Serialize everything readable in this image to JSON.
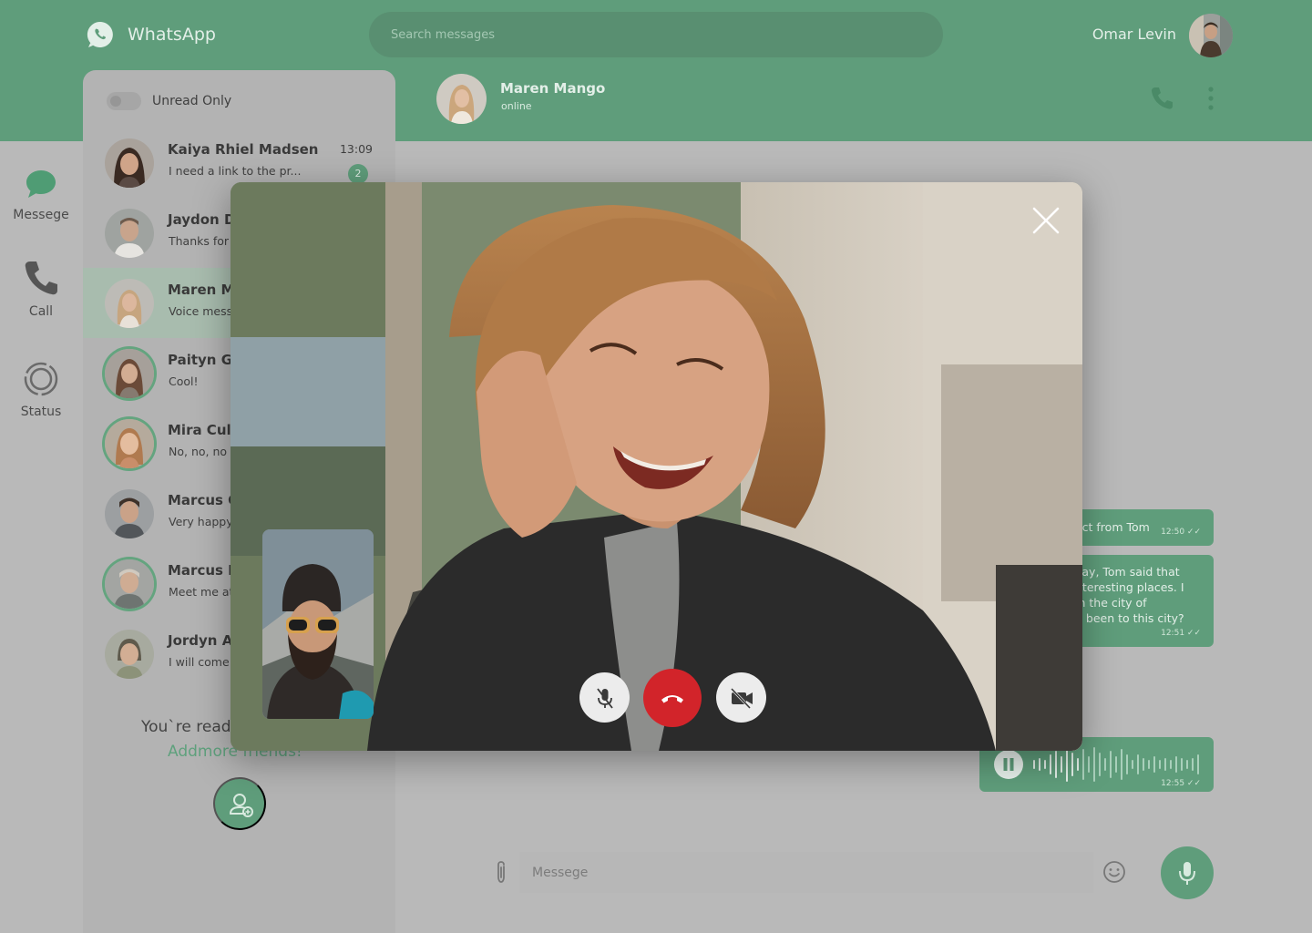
{
  "app": {
    "name": "WhatsApp"
  },
  "search": {
    "placeholder": "Search messages"
  },
  "user": {
    "name": "Omar Levin"
  },
  "nav": {
    "items": [
      {
        "label": "Messege",
        "icon": "chat-bubble-icon",
        "active": true
      },
      {
        "label": "Call",
        "icon": "phone-icon"
      },
      {
        "label": "Status",
        "icon": "status-ring-icon"
      }
    ]
  },
  "filter": {
    "label": "Unread Only",
    "enabled": false
  },
  "contacts": [
    {
      "name": "Kaiya Rhiel Madsen",
      "preview": "I need a link to the pr...",
      "time": "13:09",
      "unread": "2"
    },
    {
      "name": "Jaydon D",
      "preview": "Thanks for"
    },
    {
      "name": "Maren Ma",
      "preview": "Voice mess",
      "active": true
    },
    {
      "name": "Paityn G",
      "preview": "Cool!"
    },
    {
      "name": "Mira Culh",
      "preview": "No, no, no"
    },
    {
      "name": "Marcus C",
      "preview": "Very happy"
    },
    {
      "name": "Marcus E",
      "preview": "Meet me at"
    },
    {
      "name": "Jordyn A",
      "preview": "I will come"
    }
  ],
  "empty_state": {
    "text": "You`re read",
    "link": "Addmore friends!"
  },
  "chat": {
    "contact_name": "Maren Mango",
    "status": "online",
    "messages": [
      {
        "text": "act from Tom",
        "time": "12:50"
      },
      {
        "text": "vay, Tom said that\nnteresting places. I\nin the city of\nu been to this city?",
        "time": "12:51"
      },
      {
        "type": "voice",
        "time": "12:55"
      }
    ]
  },
  "composer": {
    "placeholder": "Messege"
  },
  "video_call": {
    "controls": [
      "mute-microphone",
      "end-call",
      "camera-off"
    ]
  },
  "colors": {
    "brand": "#5f9d7b",
    "end_call": "#d2242a",
    "overlay": "#b9b9b9"
  }
}
